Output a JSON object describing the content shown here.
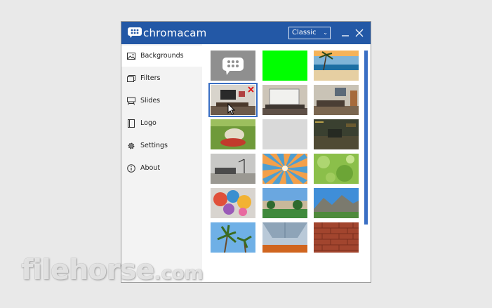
{
  "app": {
    "name": "chromacam"
  },
  "titlebar": {
    "mode_value": "Classic"
  },
  "sidebar": {
    "items": [
      {
        "label": "Backgrounds",
        "icon": "image-icon",
        "active": true
      },
      {
        "label": "Filters",
        "icon": "filters-icon",
        "active": false
      },
      {
        "label": "Slides",
        "icon": "easel-icon",
        "active": false
      },
      {
        "label": "Logo",
        "icon": "book-icon",
        "active": false
      },
      {
        "label": "Settings",
        "icon": "gear-icon",
        "active": false
      },
      {
        "label": "About",
        "icon": "info-icon",
        "active": false
      }
    ]
  },
  "backgrounds": {
    "items": [
      {
        "name": "chromacam-logo",
        "selected": false
      },
      {
        "name": "green-screen",
        "selected": false
      },
      {
        "name": "beach",
        "selected": false
      },
      {
        "name": "office-room",
        "selected": true
      },
      {
        "name": "classroom-whiteboard",
        "selected": false
      },
      {
        "name": "office-desk",
        "selected": false
      },
      {
        "name": "garden-chair",
        "selected": false
      },
      {
        "name": "gray-blank",
        "selected": false
      },
      {
        "name": "game-scene",
        "selected": false
      },
      {
        "name": "modern-interior",
        "selected": false
      },
      {
        "name": "sunburst",
        "selected": false
      },
      {
        "name": "bokeh-green",
        "selected": false
      },
      {
        "name": "colorful-art",
        "selected": false
      },
      {
        "name": "courtyard",
        "selected": false
      },
      {
        "name": "mountains",
        "selected": false
      },
      {
        "name": "palm-trees",
        "selected": false
      },
      {
        "name": "ceiling-architecture",
        "selected": false
      },
      {
        "name": "brick-wall",
        "selected": false
      }
    ]
  },
  "watermark": {
    "text": "filehorse",
    "suffix": ".com"
  },
  "colors": {
    "titlebar": "#2358a6",
    "accent": "#3a6fc4",
    "green_screen": "#00ff00"
  }
}
